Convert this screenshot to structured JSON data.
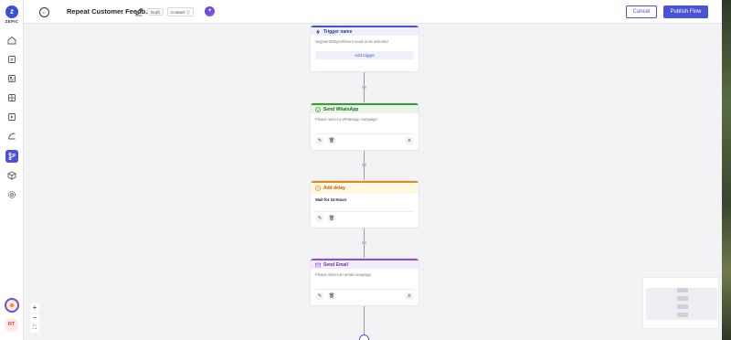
{
  "app": {
    "logo_text": "ZEPIC",
    "logo_letter": "z"
  },
  "sidebar": {
    "items": [
      {
        "name": "home-icon"
      },
      {
        "name": "contacts-icon"
      },
      {
        "name": "segments-icon"
      },
      {
        "name": "dashboard-icon"
      },
      {
        "name": "campaigns-icon"
      },
      {
        "name": "analytics-icon"
      },
      {
        "name": "flows-icon",
        "active": true
      },
      {
        "name": "templates-icon"
      },
      {
        "name": "settings-icon"
      }
    ],
    "user_initials": "RT"
  },
  "header": {
    "title": "Repeat Customer Feedb...",
    "status_badge": "Draft",
    "entity_badge": "Contact",
    "cancel_label": "Cancel",
    "publish_label": "Publish Flow"
  },
  "flow": {
    "trigger": {
      "title": "Trigger name",
      "description": "Segment/Object/Event need to be selected",
      "action": "Add trigger"
    },
    "whatsapp": {
      "title": "Send WhatsApp",
      "description": "Please select a Whatsapp campaign"
    },
    "delay": {
      "title": "Add delay",
      "description": "Wait for 24 Hours"
    },
    "email": {
      "title": "Send Email",
      "description": "Please select an email campaign"
    }
  },
  "zoom_controls": {
    "in": "+",
    "out": "−",
    "fit": "⛶"
  },
  "colors": {
    "primary": "#4a52d8",
    "whatsapp": "#3a9a35",
    "delay": "#e08a1e",
    "email": "#8b4fd8"
  }
}
